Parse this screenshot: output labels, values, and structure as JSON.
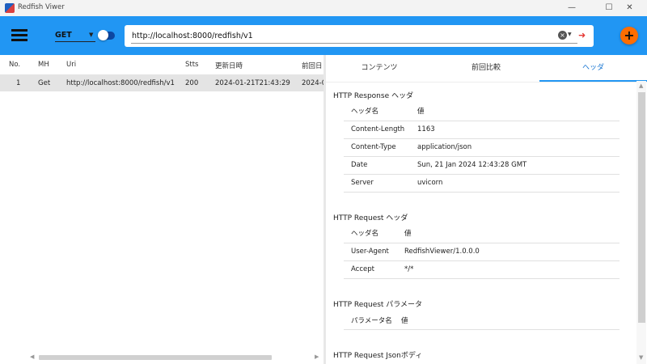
{
  "window": {
    "title": "Redfish Viwer",
    "minimize": "—",
    "maximize": "☐",
    "close": "✕"
  },
  "toolbar": {
    "method": "GET",
    "url": "http://localhost:8000/redfish/v1",
    "toggle_on": false,
    "accent": "#2196f3",
    "fab_color": "#ff6d00",
    "fab_label": "+"
  },
  "list": {
    "headers": [
      "No.",
      "MH",
      "Uri",
      "Stts",
      "更新日時",
      "前回日"
    ],
    "rows": [
      {
        "no": "1",
        "mh": "Get",
        "uri": "http://localhost:8000/redfish/v1",
        "stts": "200",
        "updated": "2024-01-21T21:43:29",
        "prev": "2024-0"
      }
    ]
  },
  "tabs": [
    {
      "label": "コンテンツ",
      "active": false
    },
    {
      "label": "前回比較",
      "active": false
    },
    {
      "label": "ヘッダ",
      "active": true
    }
  ],
  "sections": {
    "response": {
      "title": "HTTP Response ヘッダ",
      "col_name": "ヘッダ名",
      "col_value": "値",
      "rows": [
        {
          "k": "Content-Length",
          "v": "1163"
        },
        {
          "k": "Content-Type",
          "v": "application/json"
        },
        {
          "k": "Date",
          "v": "Sun, 21 Jan 2024 12:43:28 GMT"
        },
        {
          "k": "Server",
          "v": "uvicorn"
        }
      ]
    },
    "request": {
      "title": "HTTP Request ヘッダ",
      "col_name": "ヘッダ名",
      "col_value": "値",
      "rows": [
        {
          "k": "User-Agent",
          "v": "RedfishViewer/1.0.0.0"
        },
        {
          "k": "Accept",
          "v": "*/*"
        }
      ]
    },
    "params": {
      "title": "HTTP Request パラメータ",
      "col_name": "パラメータ名",
      "col_value": "値"
    },
    "json": {
      "title": "HTTP Request Jsonボディ"
    }
  }
}
